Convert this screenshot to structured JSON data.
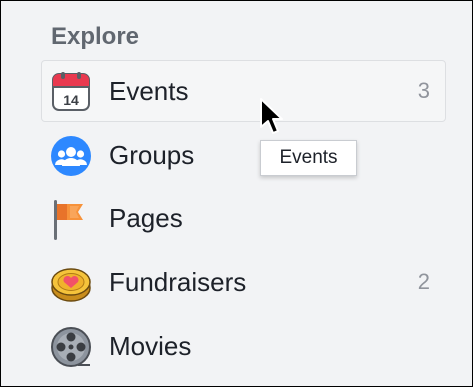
{
  "section": {
    "title": "Explore"
  },
  "items": [
    {
      "label": "Events",
      "count": "3",
      "icon": "calendar-icon"
    },
    {
      "label": "Groups",
      "count": "",
      "icon": "groups-icon"
    },
    {
      "label": "Pages",
      "count": "",
      "icon": "flag-icon"
    },
    {
      "label": "Fundraisers",
      "count": "2",
      "icon": "fundraiser-coin-icon"
    },
    {
      "label": "Movies",
      "count": "",
      "icon": "film-reel-icon"
    }
  ],
  "calendar": {
    "day": "14"
  },
  "tooltip": {
    "text": "Events"
  },
  "colors": {
    "calendar_red": "#e9394f",
    "groups_blue": "#2d88ff",
    "flag_orange": "#f7923a",
    "coin_gold": "#f5c33b",
    "heart_red": "#f25268",
    "reel_gray": "#8d949e"
  }
}
